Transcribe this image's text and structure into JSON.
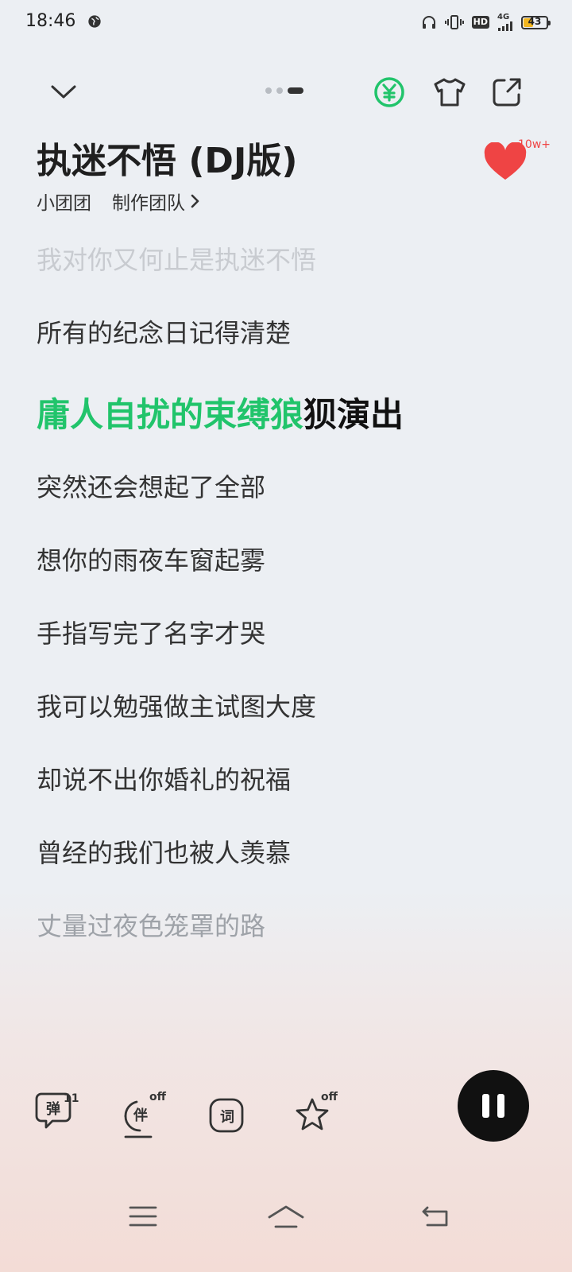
{
  "status_bar": {
    "time": "18:46",
    "network": "4G",
    "hd": "HD",
    "battery_level": 43,
    "battery_text": "43"
  },
  "toolbar": {
    "icons": [
      "chevron-down-icon",
      "vip-coin-icon",
      "tshirt-icon",
      "share-icon"
    ],
    "vip_color": "#21c46b",
    "page_dots_active": 3
  },
  "song": {
    "title": "执迷不悟 (DJ版)",
    "artist": "小团团",
    "team_label": "制作团队",
    "like_count": "10w+"
  },
  "lyrics": {
    "prev_faded": "我对你又何止是执迷不悟",
    "prev": "所有的纪念日记得清楚",
    "current_sung": "庸人自扰的束缚狼",
    "current_unsung": "狈演出",
    "next": [
      "突然还会想起了全部",
      "想你的雨夜车窗起雾",
      "手指写完了名字才哭",
      "我可以勉强做主试图大度",
      "却说不出你婚礼的祝福",
      "曾经的我们也被人羡慕"
    ],
    "next_faded": "丈量过夜色笼罩的路"
  },
  "controls": {
    "danmaku_label": "弹",
    "danmaku_count": "11",
    "accompany_label": "伴",
    "accompany_state": "off",
    "lyrics_label": "词",
    "favorite_state": "off"
  },
  "colors": {
    "accent": "#21c46b",
    "heart": "#ef4444"
  }
}
